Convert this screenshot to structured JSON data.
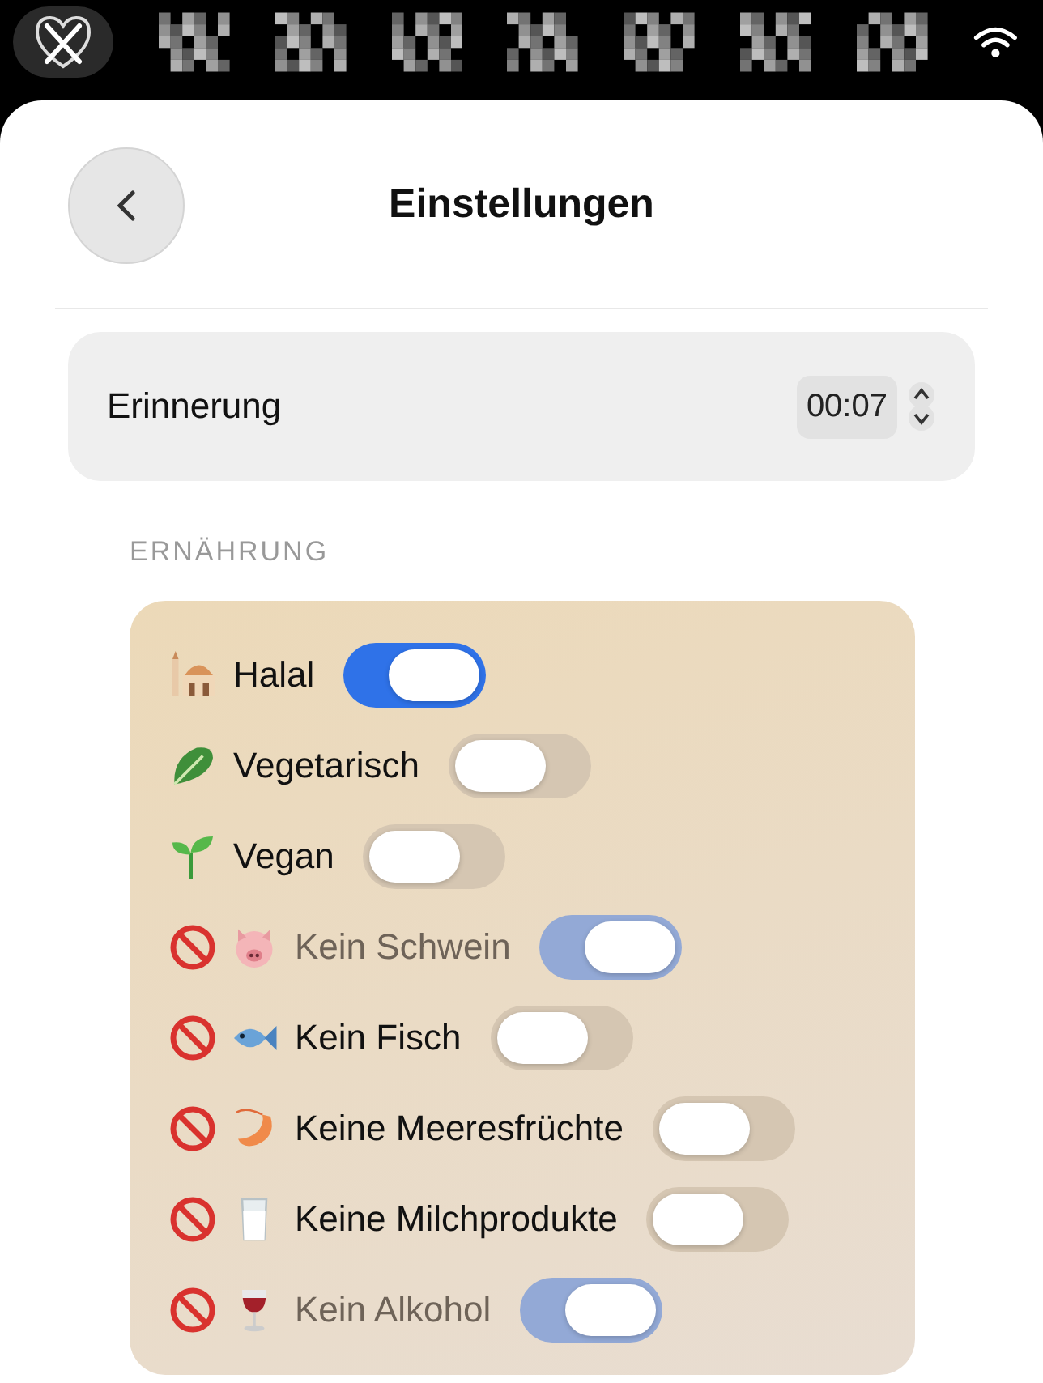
{
  "menu_bar": {
    "app_selected": true
  },
  "header": {
    "title": "Einstellungen"
  },
  "reminder": {
    "label": "Erinnerung",
    "value": "00:07"
  },
  "section": {
    "title": "ERNÄHRUNG"
  },
  "diet": [
    {
      "label": "Halal",
      "negated": false,
      "on": true,
      "disabled": false
    },
    {
      "label": "Vegetarisch",
      "negated": false,
      "on": false,
      "disabled": false
    },
    {
      "label": "Vegan",
      "negated": false,
      "on": false,
      "disabled": false
    },
    {
      "label": "Kein Schwein",
      "negated": true,
      "on": true,
      "disabled": true
    },
    {
      "label": "Kein Fisch",
      "negated": true,
      "on": false,
      "disabled": false
    },
    {
      "label": "Keine Meeresfrüchte",
      "negated": true,
      "on": false,
      "disabled": false
    },
    {
      "label": "Keine Milchprodukte",
      "negated": true,
      "on": false,
      "disabled": false
    },
    {
      "label": "Kein Alkohol",
      "negated": true,
      "on": true,
      "disabled": true
    }
  ]
}
